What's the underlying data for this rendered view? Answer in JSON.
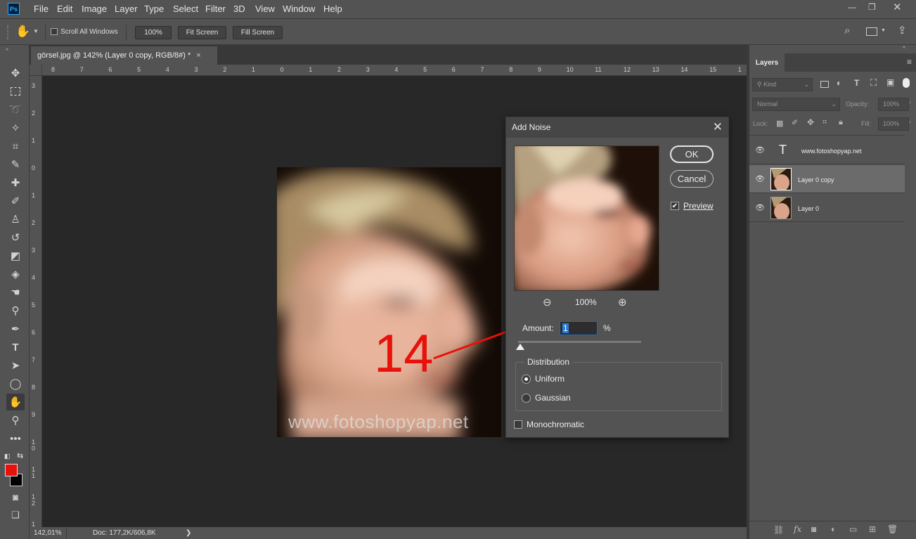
{
  "app": {
    "logo_text": "Ps"
  },
  "menubar": {
    "items": [
      "File",
      "Edit",
      "Image",
      "Layer",
      "Type",
      "Select",
      "Filter",
      "3D",
      "View",
      "Window",
      "Help"
    ]
  },
  "options": {
    "scroll_all_windows": "Scroll All Windows",
    "zoom_100": "100%",
    "fit_screen": "Fit Screen",
    "fill_screen": "Fill Screen"
  },
  "document": {
    "tab_title": "görsel.jpg @ 142% (Layer 0 copy, RGB/8#) *",
    "tab_close": "×",
    "watermark": "www.fotoshopyap.net"
  },
  "rulers": {
    "top": [
      "8",
      "7",
      "6",
      "5",
      "4",
      "3",
      "2",
      "1",
      "0",
      "1",
      "2",
      "3",
      "4",
      "5",
      "6",
      "7",
      "8",
      "9",
      "10",
      "11",
      "12",
      "13",
      "14",
      "15",
      "1"
    ],
    "left": [
      "3",
      "2",
      "1",
      "0",
      "1",
      "2",
      "3",
      "4",
      "5",
      "6",
      "7",
      "8",
      "9",
      "1\n0",
      "1\n1",
      "1\n2",
      "1\n3"
    ]
  },
  "status": {
    "zoom": "142,01%",
    "doc": "Doc: 177,2K/606,8K",
    "arrow": "❯"
  },
  "annotation": {
    "number": "14"
  },
  "dialog": {
    "title": "Add Noise",
    "ok": "OK",
    "cancel": "Cancel",
    "preview_label": "Preview",
    "preview_checked": true,
    "zoom_value": "100%",
    "amount_label": "Amount:",
    "amount_value": "1",
    "amount_unit": "%",
    "distribution_title": "Distribution",
    "uniform": "Uniform",
    "gaussian": "Gaussian",
    "distribution_selected": "Uniform",
    "monochromatic": "Monochromatic",
    "monochromatic_checked": false
  },
  "layers_panel": {
    "tab": "Layers",
    "kind": "Kind",
    "blend_mode": "Normal",
    "opacity_label": "Opacity:",
    "opacity_value": "100%",
    "lock_label": "Lock:",
    "fill_label": "Fill:",
    "fill_value": "100%",
    "layers": [
      {
        "name": "www.fotoshopyap.net",
        "type": "text",
        "selected": false
      },
      {
        "name": "Layer 0 copy",
        "type": "image",
        "selected": true
      },
      {
        "name": "Layer 0",
        "type": "image",
        "selected": false
      }
    ]
  },
  "colors": {
    "foreground": "#e8110b",
    "background": "#000000",
    "annotation_red": "#e8110b",
    "accent_blue": "#2b7bd8"
  }
}
